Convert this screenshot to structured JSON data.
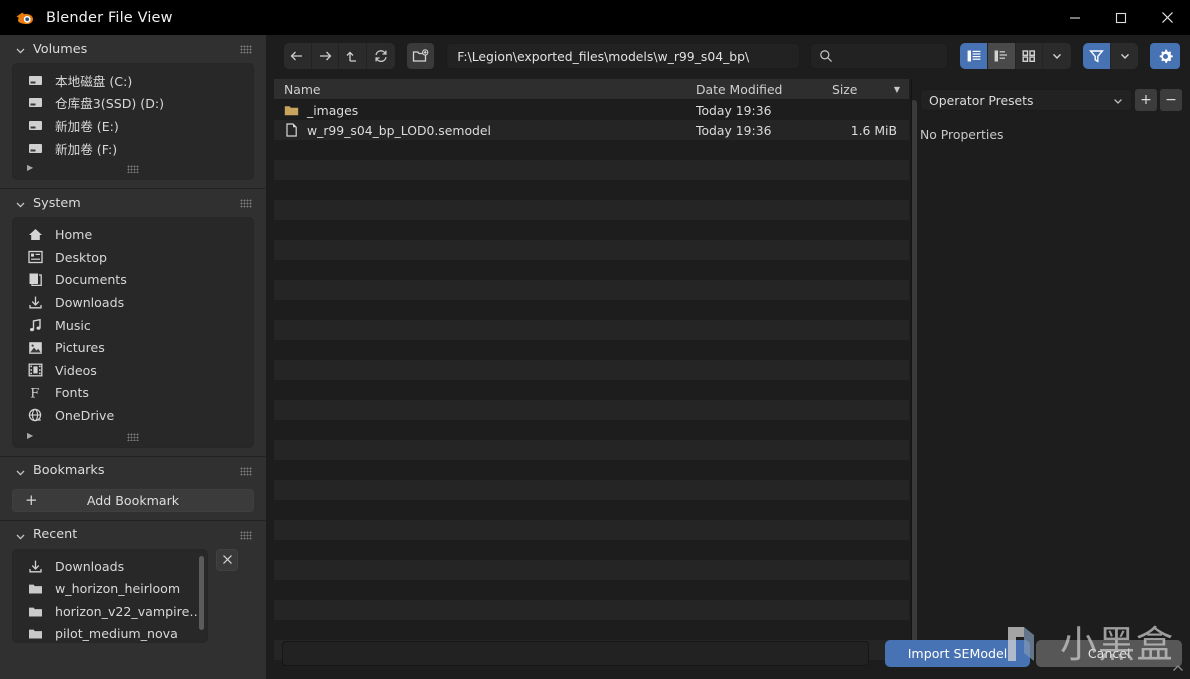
{
  "window": {
    "title": "Blender File View",
    "logo_icon": "blender-logo-icon",
    "minimize_label": "—",
    "maximize_label": "□",
    "close_label": "✕"
  },
  "sidebar": {
    "panels": [
      {
        "id": "volumes",
        "title": "Volumes",
        "chevron_icon": "chevron-down-icon",
        "grip_icon": "grip-dots-icon",
        "items": [
          {
            "label": "本地磁盘 (C:)",
            "icon": "drive-icon"
          },
          {
            "label": "仓库盘3(SSD) (D:)",
            "icon": "drive-icon"
          },
          {
            "label": "新加卷 (E:)",
            "icon": "drive-icon"
          },
          {
            "label": "新加卷 (F:)",
            "icon": "drive-icon"
          }
        ],
        "more_icon": "triangle-right-icon"
      },
      {
        "id": "system",
        "title": "System",
        "chevron_icon": "chevron-down-icon",
        "grip_icon": "grip-dots-icon",
        "items": [
          {
            "label": "Home",
            "icon": "home-icon"
          },
          {
            "label": "Desktop",
            "icon": "desktop-icon"
          },
          {
            "label": "Documents",
            "icon": "documents-icon"
          },
          {
            "label": "Downloads",
            "icon": "download-icon"
          },
          {
            "label": "Music",
            "icon": "music-note-icon"
          },
          {
            "label": "Pictures",
            "icon": "picture-icon"
          },
          {
            "label": "Videos",
            "icon": "film-icon"
          },
          {
            "label": "Fonts",
            "icon": "font-f-icon"
          },
          {
            "label": "OneDrive",
            "icon": "globe-cloud-icon"
          }
        ],
        "more_icon": "triangle-right-icon"
      },
      {
        "id": "bookmarks",
        "title": "Bookmarks",
        "chevron_icon": "chevron-down-icon",
        "grip_icon": "grip-dots-icon",
        "add_label": "Add Bookmark",
        "add_icon": "plus-icon"
      },
      {
        "id": "recent",
        "title": "Recent",
        "chevron_icon": "chevron-down-icon",
        "grip_icon": "grip-dots-icon",
        "clear_icon": "close-x-icon",
        "items": [
          {
            "label": "Downloads",
            "icon": "download-icon"
          },
          {
            "label": "w_horizon_heirloom",
            "icon": "folder-icon"
          },
          {
            "label": "horizon_v22_vampire…",
            "icon": "folder-icon"
          },
          {
            "label": "pilot_medium_nova",
            "icon": "folder-icon"
          }
        ]
      }
    ]
  },
  "toolbar": {
    "back_icon": "arrow-left-icon",
    "forward_icon": "arrow-right-icon",
    "up_icon": "arrow-up-parent-icon",
    "refresh_icon": "refresh-icon",
    "new_folder_icon": "new-folder-icon",
    "path_value": "F:\\Legion\\exported_files\\models\\w_r99_s04_bp\\",
    "search_icon": "search-icon",
    "search_value": "",
    "search_placeholder": "",
    "view_buttons": [
      {
        "icon": "vertical-list-view-icon",
        "state": "active"
      },
      {
        "icon": "horizontal-list-view-icon",
        "state": "semi"
      },
      {
        "icon": "thumbnail-grid-view-icon",
        "state": "normal"
      },
      {
        "icon": "chevron-down-icon",
        "state": "normal"
      }
    ],
    "filter_buttons": [
      {
        "icon": "funnel-filter-icon",
        "state": "active"
      },
      {
        "icon": "chevron-down-icon",
        "state": "normal"
      }
    ],
    "settings_icon": "gear-icon"
  },
  "filelist": {
    "columns": [
      {
        "key": "name",
        "label": "Name"
      },
      {
        "key": "date",
        "label": "Date Modified"
      },
      {
        "key": "size",
        "label": "Size",
        "sort_icon": "sort-descending-arrow-icon"
      }
    ],
    "rows": [
      {
        "name": "_images",
        "date": "Today 19:36",
        "size": "",
        "icon": "folder-icon"
      },
      {
        "name": "w_r99_s04_bp_LOD0.semodel",
        "date": "Today 19:36",
        "size": "1.6 MiB",
        "icon": "file-icon"
      }
    ],
    "scrollbar_icon": "vertical-scrollbar"
  },
  "properties": {
    "preset_value": "Operator Presets",
    "preset_chevron_icon": "chevron-down-icon",
    "add_preset_label": "+",
    "remove_preset_label": "−",
    "empty_text": "No Properties"
  },
  "bottom": {
    "filename_value": "",
    "filename_placeholder": "",
    "confirm_label": "Import SEModel",
    "cancel_label": "Cancel",
    "resize_icon": "resize-grip-icon"
  },
  "watermark": {
    "text": "小黑盒",
    "logo_icon": "heybox-logo-icon"
  },
  "colors": {
    "accent": "#4772b3",
    "window_bg": "#1d1d1d",
    "sidebar_bg": "#303030",
    "panel_box_bg": "#282828",
    "titlebar_bg": "#000000",
    "folder_icon": "#c8a45e",
    "text": "#dcdcdc"
  }
}
